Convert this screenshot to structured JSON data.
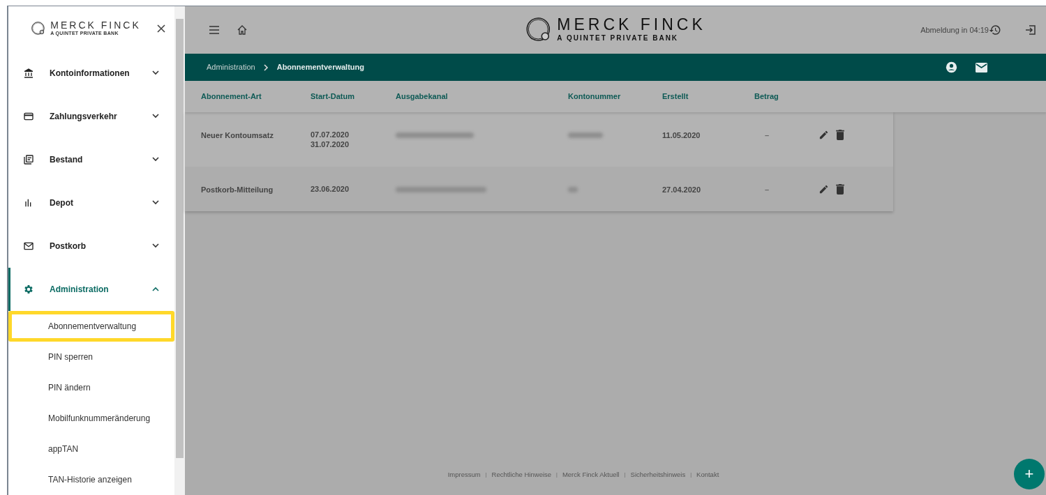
{
  "sidebar": {
    "logo": {
      "name": "MERCK FINCK",
      "tagline": "A QUINTET PRIVATE BANK"
    },
    "items": [
      {
        "label": "Kontoinformationen",
        "expanded": false,
        "selected": false
      },
      {
        "label": "Zahlungsverkehr",
        "expanded": false,
        "selected": false
      },
      {
        "label": "Bestand",
        "expanded": false,
        "selected": false
      },
      {
        "label": "Depot",
        "expanded": false,
        "selected": false
      },
      {
        "label": "Postkorb",
        "expanded": false,
        "selected": false
      },
      {
        "label": "Administration",
        "expanded": true,
        "selected": true,
        "children": [
          {
            "label": "Abonnementverwaltung",
            "selected": true
          },
          {
            "label": "PIN sperren",
            "selected": false
          },
          {
            "label": "PIN ändern",
            "selected": false
          },
          {
            "label": "Mobilfunknummeränderung",
            "selected": false
          },
          {
            "label": "appTAN",
            "selected": false
          },
          {
            "label": "TAN-Historie anzeigen",
            "selected": false
          }
        ]
      }
    ]
  },
  "header": {
    "logo": {
      "name": "MERCK FINCK",
      "tagline": "A QUINTET PRIVATE BANK"
    },
    "logout_timer": "Abmeldung in 04:19"
  },
  "breadcrumb": [
    "Administration",
    "Abonnementverwaltung"
  ],
  "table": {
    "columns": [
      "Abonnement-Art",
      "Start-Datum",
      "Ausgabekanal",
      "Kontonummer",
      "Erstellt",
      "Betrag"
    ],
    "rows": [
      {
        "type": "Neuer Kontoumsatz",
        "start": [
          "07.07.2020",
          "31.07.2020"
        ],
        "channel_redacted": true,
        "account_redacted": true,
        "created": "11.05.2020",
        "amount": "–"
      },
      {
        "type": "Postkorb-Mitteilung",
        "start": [
          "23.06.2020"
        ],
        "channel_redacted": true,
        "account_redacted": true,
        "created": "27.04.2020",
        "amount": "–"
      }
    ]
  },
  "footer": {
    "links": [
      "Impressum",
      "Rechtliche Hinweise",
      "Merck Finck Aktuell",
      "Sicherheitshinweis",
      "Kontakt"
    ],
    "separator": "|"
  },
  "fab": "+"
}
